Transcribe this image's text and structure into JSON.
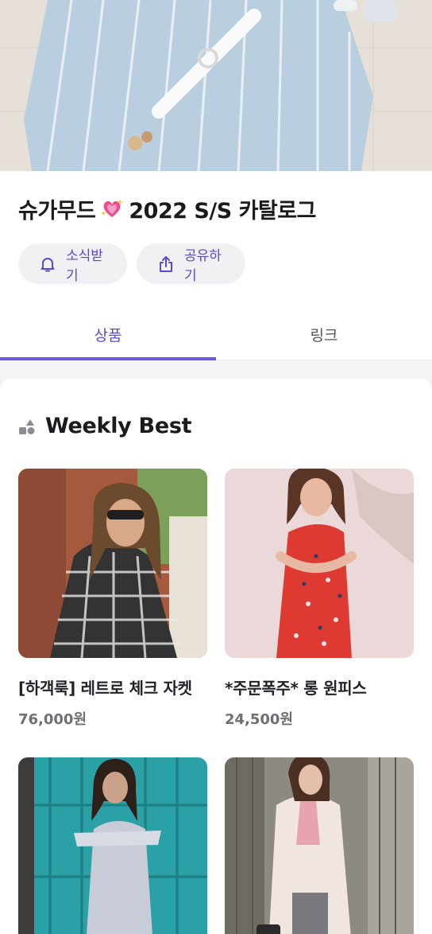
{
  "catalog": {
    "title_before_emoji": "슈가무드",
    "title_after_emoji": "2022 S/S 카탈로그",
    "emoji_icon": "sparkling-heart-emoji"
  },
  "actions": {
    "subscribe_label": "소식받기",
    "share_label": "공유하기"
  },
  "tabs": [
    {
      "label": "상품",
      "active": true
    },
    {
      "label": "링크",
      "active": false
    }
  ],
  "section": {
    "title": "Weekly Best",
    "icon": "shapes-icon"
  },
  "products": [
    {
      "name": "[하객룩] 레트로 체크 자켓",
      "price": "76,000원"
    },
    {
      "name": "*주문폭주* 롱 원피스",
      "price": "24,500원"
    },
    {
      "name": "",
      "price": ""
    },
    {
      "name": "",
      "price": ""
    }
  ],
  "colors": {
    "accent": "#5b49d6",
    "tab_underline": "#6a5ae0"
  }
}
